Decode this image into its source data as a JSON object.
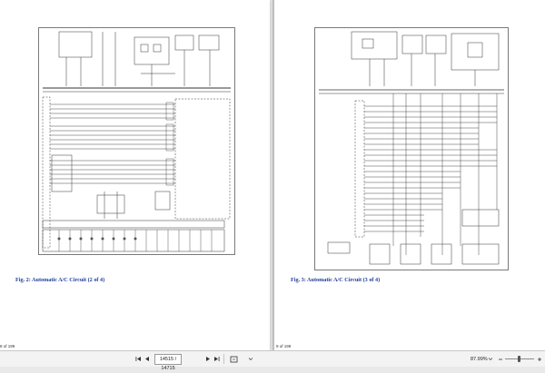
{
  "document": {
    "left_page": {
      "caption": "Fig. 2: Automatic A/C Circuit (2 of 4)",
      "page_number": "8 of 199"
    },
    "right_page": {
      "caption": "Fig. 3: Automatic A/C Circuit (3 of 4)",
      "page_number": "9 of 199"
    }
  },
  "toolbar": {
    "first_page_icon": "first-page-icon",
    "prev_page_icon": "previous-page-icon",
    "current_page": "14515 / 14715",
    "next_page_icon": "next-page-icon",
    "last_page_icon": "last-page-icon",
    "fit_page_icon": "fit-page-icon",
    "zoom_level": "87.99%",
    "zoom_out_icon": "minus-icon",
    "zoom_in_icon": "plus-icon"
  },
  "colors": {
    "caption": "#1f3f9a",
    "toolbar_bg": "#f3f3f4",
    "viewer_bg": "#ececed"
  }
}
